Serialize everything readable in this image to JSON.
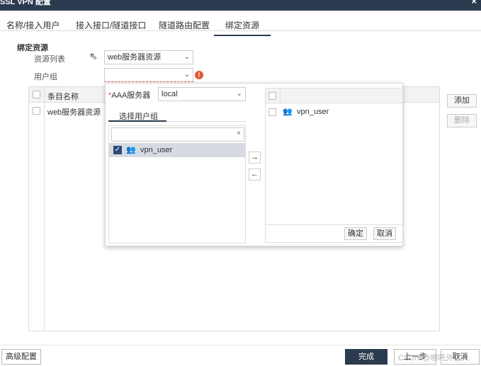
{
  "window": {
    "title": "SSL VPN 配置",
    "close": "×"
  },
  "tabs": [
    {
      "label": "名称/接入用户"
    },
    {
      "label": "接入接口/隧道接口"
    },
    {
      "label": "隧道路由配置"
    },
    {
      "label": "绑定资源"
    }
  ],
  "form": {
    "section_title": "绑定资源",
    "resource_list_label": "资源列表",
    "resource_list_value": "web服务器资源",
    "user_group_label": "用户组",
    "user_group_value": "",
    "error_icon": "!"
  },
  "grid": {
    "column_name": "条目名称",
    "rows": [
      {
        "name": "web服务器资源"
      }
    ]
  },
  "side_buttons": {
    "add": "添加",
    "delete": "删除"
  },
  "popup": {
    "aaa_label": "AAA服务器",
    "required_mark": "*",
    "aaa_value": "local",
    "subtab_label": "选择用户组",
    "search_placeholder": "",
    "search_clear": "×",
    "left_items": [
      {
        "label": "vpn_user",
        "checked": true
      }
    ],
    "right_items": [
      {
        "label": "vpn_user"
      }
    ],
    "move_right": "→",
    "move_left": "←",
    "confirm": "确定",
    "cancel": "取消"
  },
  "footer": {
    "advanced": "高级配置",
    "finish": "完成",
    "prev": "上一步",
    "cancel": "取消"
  },
  "watermark": "CSDN @哪吒外之人"
}
